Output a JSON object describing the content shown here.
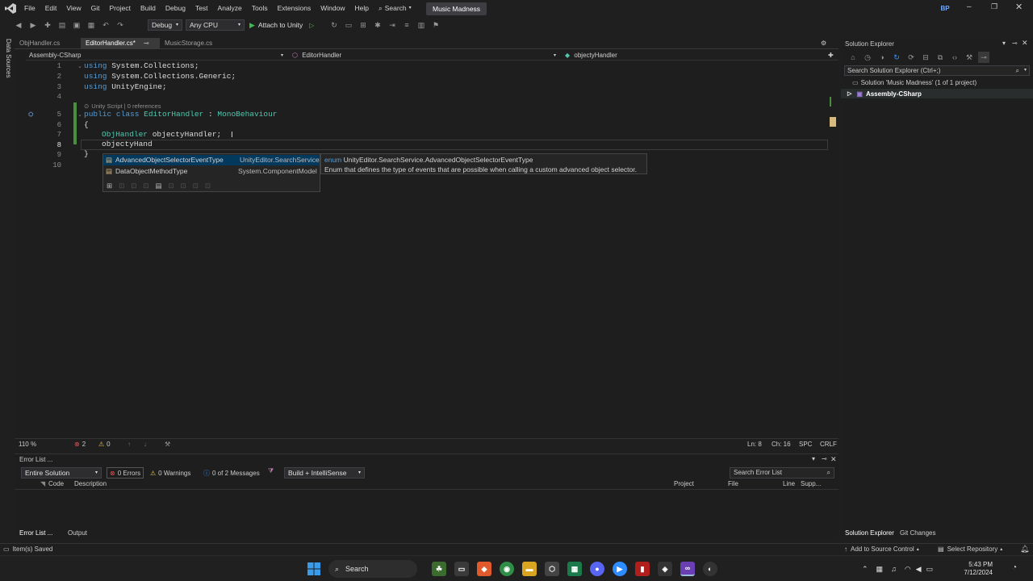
{
  "menubar": {
    "items": [
      "File",
      "Edit",
      "View",
      "Git",
      "Project",
      "Build",
      "Debug",
      "Test",
      "Analyze",
      "Tools",
      "Extensions",
      "Window",
      "Help"
    ],
    "search_label": "Search",
    "solution_title": "Music Madness",
    "user_initials": "BP"
  },
  "toolbar": {
    "config": "Debug",
    "platform": "Any CPU",
    "attach_label": "Attach to Unity"
  },
  "left_sidebar": {
    "label": "Data Sources"
  },
  "tabs": [
    {
      "label": "ObjHandler.cs",
      "active": false
    },
    {
      "label": "EditorHandler.cs*",
      "active": true
    },
    {
      "label": "MusicStorage.cs",
      "active": false
    }
  ],
  "navbar": {
    "project": "Assembly-CSharp",
    "class": "EditorHandler",
    "member": "objectyHandler"
  },
  "code": {
    "line_numbers": [
      "1",
      "2",
      "3",
      "4",
      "5",
      "6",
      "7",
      "8",
      "9",
      "10"
    ],
    "line1_kw": "using",
    "line1_rest": " System.Collections;",
    "line2_kw": "using",
    "line2_rest": " System.Collections.Generic;",
    "line3_kw": "using",
    "line3_rest": " UnityEngine;",
    "codelens": "Unity Script | 0 references",
    "line5_kw1": "public",
    "line5_kw2": "class",
    "line5_type": "EditorHandler",
    "line5_colon": " : ",
    "line5_base": "MonoBehaviour",
    "line6": "{",
    "line7_type": "ObjHandler",
    "line7_rest": " objectyHandler;",
    "line8": "objectyHand",
    "line9": "}"
  },
  "autocomplete": {
    "items": [
      {
        "name": "AdvancedObjectSelectorEventType",
        "ns": "UnityEditor.SearchService"
      },
      {
        "name": "DataObjectMethodType",
        "ns": "System.ComponentModel"
      }
    ]
  },
  "tooltip": {
    "kind": "enum",
    "signature": "UnityEditor.SearchService.AdvancedObjectSelectorEventType",
    "description": "Enum that defines the type of events that are possible when calling a custom advanced object selector."
  },
  "editor_status": {
    "zoom": "110 %",
    "errors": "2",
    "warnings": "0",
    "line": "Ln: 8",
    "col": "Ch: 16",
    "spc": "SPC",
    "crlf": "CRLF"
  },
  "error_list": {
    "title": "Error List ...",
    "scope": "Entire Solution",
    "errors_btn": "0 Errors",
    "warnings_btn": "0 Warnings",
    "messages_btn": "0 of 2 Messages",
    "build_filter": "Build + IntelliSense",
    "search_placeholder": "Search Error List",
    "columns": [
      "Code",
      "Description",
      "Project",
      "File",
      "Line",
      "Supp..."
    ],
    "bottom_tabs": [
      "Error List ...",
      "Output"
    ]
  },
  "solution_explorer": {
    "title": "Solution Explorer",
    "search_placeholder": "Search Solution Explorer (Ctrl+;)",
    "solution_label": "Solution 'Music Madness' (1 of 1 project)",
    "project_label": "Assembly-CSharp",
    "bottom_tabs": [
      "Solution Explorer",
      "Git Changes"
    ]
  },
  "status_bar": {
    "left": "Item(s) Saved",
    "add_source": "Add to Source Control",
    "select_repo": "Select Repository"
  },
  "taskbar": {
    "search": "Search",
    "time": "5:43 PM",
    "date": "7/12/2024"
  }
}
